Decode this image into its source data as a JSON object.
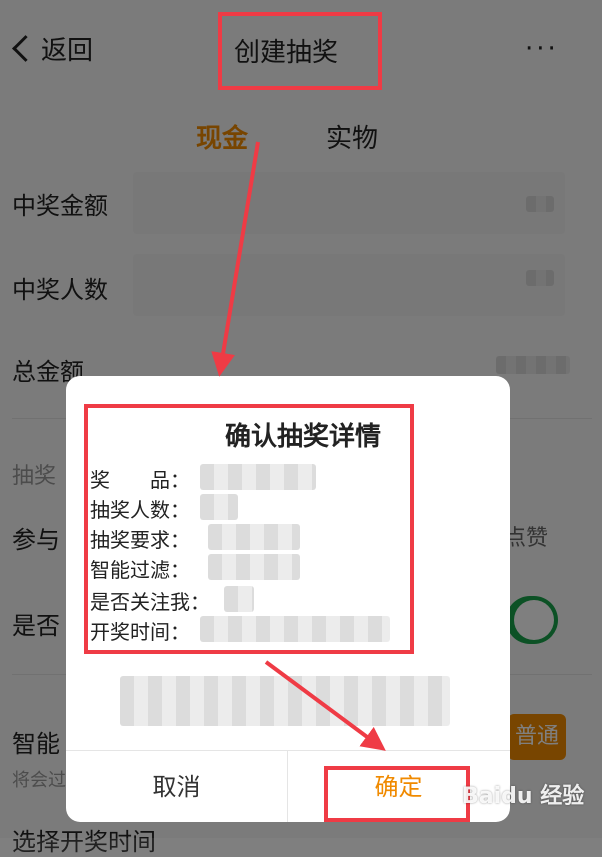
{
  "nav": {
    "back_label": "返回",
    "title": "创建抽奖",
    "more": "···"
  },
  "tabs": [
    {
      "label": "现金"
    },
    {
      "label": "实物"
    }
  ],
  "form": {
    "prize_amount_label": "中奖金额",
    "winner_count_label": "中奖人数",
    "total_amount_label": "总金额",
    "section_label": "抽奖",
    "participate_label": "参与",
    "participate_hint": "点赞",
    "follow_label": "是否",
    "smart_label": "智能",
    "smart_hint": "将会过",
    "normal_pill": "普通",
    "open_time_label": "选择开奖时间"
  },
  "dialog": {
    "title": "确认抽奖详情",
    "lines": [
      {
        "label": "奖　　品："
      },
      {
        "label": "抽奖人数："
      },
      {
        "label": "抽奖要求："
      },
      {
        "label": "智能过滤："
      },
      {
        "label": "是否关注我："
      },
      {
        "label": "开奖时间："
      }
    ],
    "cancel": "取消",
    "confirm": "确定"
  },
  "watermark": "Baidu 经验",
  "colors": {
    "accent": "#f08a00",
    "annotation_red": "#ef3b45",
    "toggle_green": "#19a34a"
  }
}
